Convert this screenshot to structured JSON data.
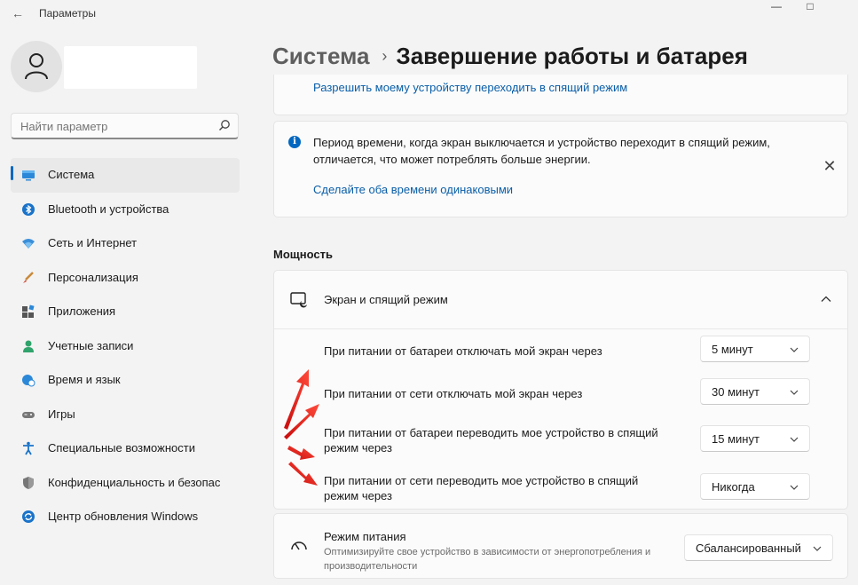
{
  "window": {
    "title": "Параметры",
    "back_icon": "arrow-left-icon",
    "controls": [
      "minimize-icon",
      "maximize-icon"
    ]
  },
  "sidebar": {
    "search": {
      "placeholder": "Найти параметр",
      "icon": "search-icon"
    },
    "items": [
      {
        "label": "Система",
        "icon": "display-icon",
        "active": true
      },
      {
        "label": "Bluetooth и устройства",
        "icon": "bluetooth-icon"
      },
      {
        "label": "Сеть и Интернет",
        "icon": "wifi-icon"
      },
      {
        "label": "Персонализация",
        "icon": "brush-icon"
      },
      {
        "label": "Приложения",
        "icon": "apps-icon"
      },
      {
        "label": "Учетные записи",
        "icon": "account-icon"
      },
      {
        "label": "Время и язык",
        "icon": "globe-clock-icon"
      },
      {
        "label": "Игры",
        "icon": "gamepad-icon"
      },
      {
        "label": "Специальные возможности",
        "icon": "accessibility-icon"
      },
      {
        "label": "Конфиденциальность и безопас",
        "icon": "shield-icon"
      },
      {
        "label": "Центр обновления Windows",
        "icon": "update-icon"
      }
    ]
  },
  "breadcrumb": {
    "parent": "Система",
    "separator": "›",
    "current": "Завершение работы и батарея"
  },
  "main": {
    "top_link": "Разрешить моему устройству переходить в спящий режим",
    "info": {
      "text": "Период времени, когда экран выключается и устройство переходит в спящий режим, отличается, что может потреблять больше энергии.",
      "link": "Сделайте оба времени одинаковыми"
    },
    "section_title": "Мощность",
    "screen_sleep": {
      "title": "Экран и спящий режим",
      "rows": [
        {
          "label": "При питании от батареи отключать мой экран через",
          "value": "5 минут"
        },
        {
          "label": "При питании от сети отключать мой экран через",
          "value": "30 минут"
        },
        {
          "label": "При питании от батареи переводить мое устройство в спящий режим через",
          "value": "15 минут"
        },
        {
          "label": "При питании от сети переводить мое устройство в спящий режим через",
          "value": "Никогда"
        }
      ]
    },
    "power_mode": {
      "title": "Режим питания",
      "description": "Оптимизируйте свое устройство в зависимости от энергопотребления и производительности",
      "value": "Сбалансированный"
    }
  },
  "colors": {
    "accent": "#0067c0",
    "link": "#0a5ea8",
    "annotation_arrow": "#e01818"
  }
}
